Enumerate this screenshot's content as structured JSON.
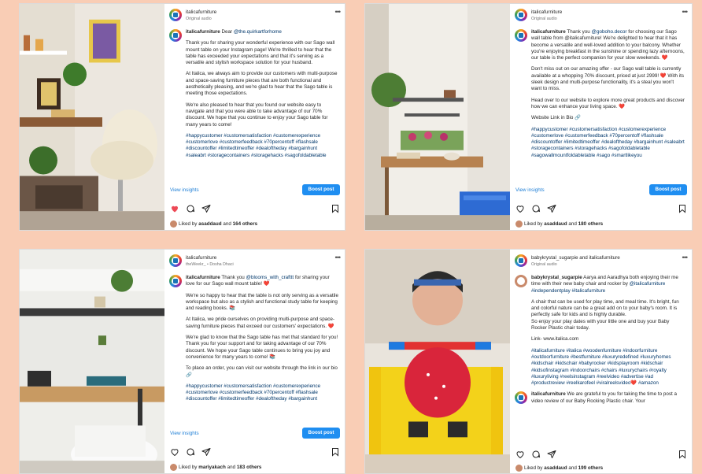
{
  "posts": [
    {
      "username": "italicafurniture",
      "subtitle": "Original audio",
      "caption_user": "italicafurniture",
      "caption_lead": "Dear",
      "mention": "@the.quirkartforhome",
      "paragraphs": [
        "Thank you for sharing your wonderful experience with our Sago wall mount table on your Instagram page! We're thrilled to hear that the table has exceeded your expectations and that it's serving as a versatile and stylish workspace solution for your husband.",
        "At Italica, we always aim to provide our customers with multi-purpose and space-saving furniture pieces that are both functional and aesthetically pleasing, and we're glad to hear that the Sago table is meeting those expectations.",
        "We're also pleased to hear that you found our website easy to navigate and that you were able to take advantage of our 70% discount. We hope that you continue to enjoy your Sago table for many years to come!"
      ],
      "hashtags": "#happycustomer #customersatisfaction #customerexperience #customerlove #customerfeedback #70percentoff #flashsale #discountoffer #limitedtimeoffer #dealoftheday #bargainhunt #saleabrt #storagecontainers #storagehacks #sagofoldabletable",
      "view_insights": "View insights",
      "boost": "Boost post",
      "liked_by_user": "asaddaud",
      "liked_count": "164 others",
      "liked_prefix": "Liked by",
      "liked_and": "and",
      "liked_heart": true
    },
    {
      "username": "italicafurniture",
      "subtitle": "Original audio",
      "caption_user": "italicafurniture",
      "caption_lead": "Thank you",
      "mention": "@goboho.decor",
      "paragraphs": [
        "for choosing our Sago wall table from @italicafurniture! We're delighted to hear that it has become a versatile and well-loved addition to your balcony. Whether you're enjoying breakfast in the sunshine or spending lazy afternoons, our table is the perfect companion for your slow weekends. ❤️",
        "Don't miss out on our amazing offer - our Sago wall table is currently available at a whopping 70% discount, priced at just 2999! ❤️ With its sleek design and multi-purpose functionality, it's a steal you won't want to miss.",
        "Head over to our website to explore more great products and discover how we can enhance your living space. ❤️",
        "Website Link in Bio 🔗"
      ],
      "hashtags": "#happycustomer #customersatisfaction #customerexperience #customerlove #customerfeedback #70percentoff #flashsale #discountoffer #limitedtimeoffer #dealoftheday #bargainhunt #saleabrt #storagecontainers #storagehacks #sagofoldabletable #sagowallmountfoldabletable #sago #smartlikeyou",
      "view_insights": "View insights",
      "boost": "Boost post",
      "liked_by_user": "asaddaud",
      "liked_count": "180 others",
      "liked_prefix": "Liked by",
      "liked_and": "and",
      "liked_heart": false
    },
    {
      "username": "italicafurniture",
      "subtitle": "theWeekr_ • Dosha Dhaci",
      "caption_user": "italicafurniture",
      "caption_lead": "Thank you",
      "mention": "@blooms_with_crafttt",
      "paragraphs": [
        "for sharing your love for our Sago wall mount table! ❤️",
        "We're so happy to hear that the table is not only serving as a versatile workspace but also as a stylish and functional study table for keeping and reading books. 📚",
        "At Italica, we pride ourselves on providing multi-purpose and space-saving furniture pieces that exceed our customers' expectations. ❤️",
        "We're glad to know that the Sago table has met that standard for you! Thank you for your support and for taking advantage of our 70% discount. We hope your Sago table continues to bring you joy and convenience for many years to come! 📚",
        "To place an order, you can visit our website through the link in our bio 🔗"
      ],
      "hashtags": "#happycustomer #customersatisfaction #customerexperience #customerlove #customerfeedback #70percentoff #flashsale #discountoffer #limitedtimeoffer #dealoftheday #bargainhunt",
      "view_insights": "View insights",
      "boost": "Boost post",
      "liked_by_user": "mariyakach",
      "liked_count": "183 others",
      "liked_prefix": "Liked by",
      "liked_and": "and",
      "liked_heart": false
    },
    {
      "username": "babykrystal_sugarpie and italicafurniture",
      "subtitle": "Original audio",
      "caption_user": "babykrystal_sugarpie",
      "caption_lead": "Aarya and Aaradhya both enjoying their me time with their new baby chair and rocker by",
      "mention": "@italicafurniture #independentplay #italicafurniture",
      "paragraphs": [
        "A chair that can be used for play time, and meal time. It's bright, fun and colorful nature can be a great add on to your baby's room. It is perfectly safe for kids and is highly durable.",
        "So enjoy your play dates with your little one and buy your Baby Rocker Plastic chair today.",
        "Link- www.italica.com"
      ],
      "hashtags": "#italicafurniture #italica #woodenfurniture #indoorfurniture #outdoorfurniture #bestfurniture #luxuryredefined #luxuryhomes #kidschair #kidschair #babyrocker #kidsplayroom #kidschair #kidsofinstagram #indoorchairs #chairs #luxurychairs #royalty #luxuryliving #reelsinstagram #reelvideo #advertise #ad #productreview #reelkarofeel #viralreelsvideo❤️ #amazon",
      "reply_user": "italicafurniture",
      "reply_text": "We are grateful to you for taking the time to post a video review of our Baby Rocking Plastic chair. Your",
      "liked_by_user": "asaddaud",
      "liked_count": "199 others",
      "liked_prefix": "Liked by",
      "liked_and": "and",
      "liked_heart": false
    }
  ],
  "icons": [
    "heart-icon",
    "comment-icon",
    "share-icon",
    "save-icon",
    "more-options-icon"
  ],
  "colors": {
    "background": "#f9cdb5",
    "boost": "#1f8ef1",
    "link": "#00376b",
    "heart": "#ed4956"
  }
}
